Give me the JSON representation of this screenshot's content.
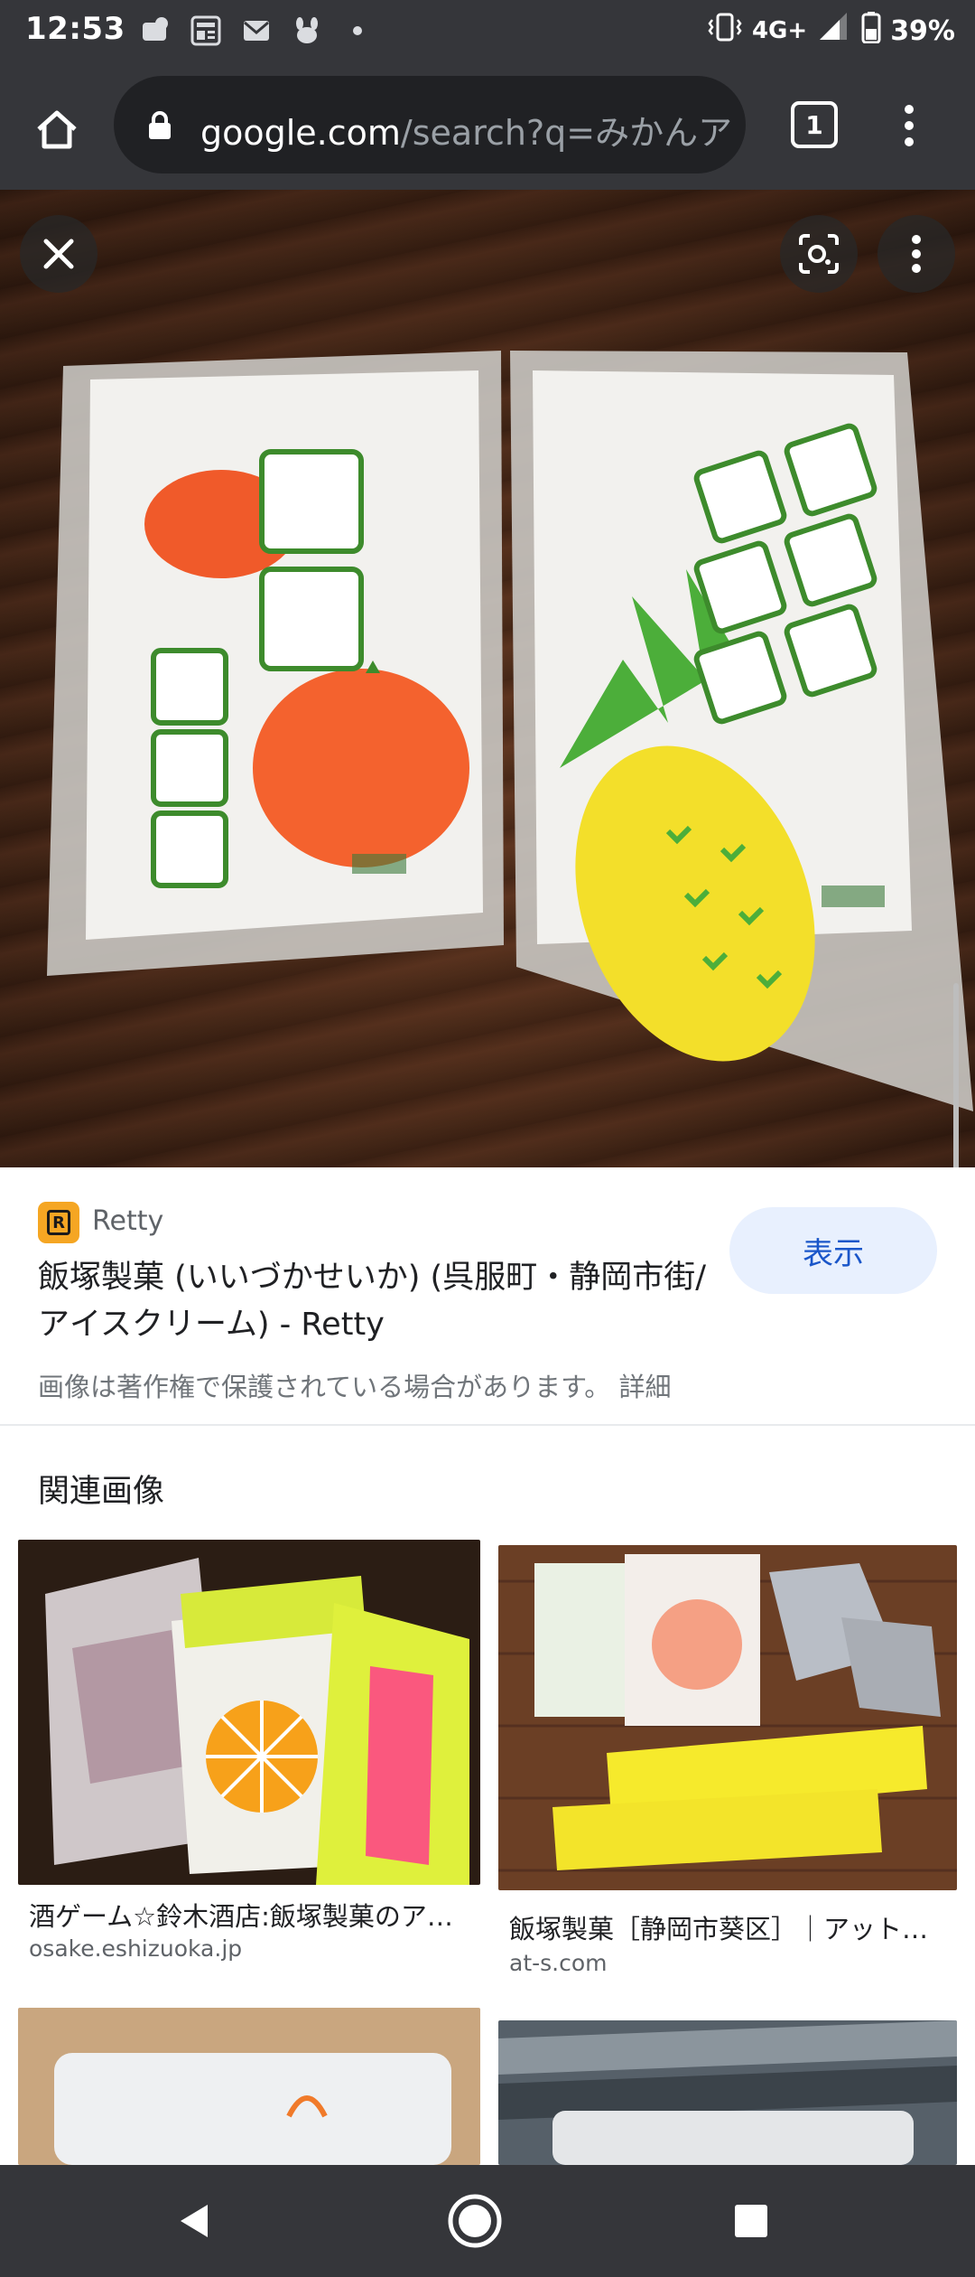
{
  "status_bar": {
    "time": "12:53",
    "network": "4G+",
    "battery": "39%",
    "icons_left": [
      "app-icon",
      "news-icon",
      "mail-icon",
      "pet-icon",
      "dot-icon"
    ],
    "icons_right": [
      "vibrate-icon",
      "signal-icon",
      "battery-icon"
    ]
  },
  "browser": {
    "url_host": "google.com",
    "url_path": "/search?q=みかんア",
    "tab_count": "1"
  },
  "source": {
    "site": "Retty",
    "favicon_letter": "R",
    "title": "飯塚製菓 (いいづかせいか) (呉服町・静岡市街/アイスクリーム) - Retty",
    "visit_label": "表示",
    "copyright": "画像は著作権で保護されている場合があります。",
    "details": "詳細"
  },
  "related": {
    "heading": "関連画像",
    "items": [
      {
        "caption": "酒ゲーム☆鈴木酒店:飯塚製菓のア…",
        "domain": "osake.eshizuoka.jp"
      },
      {
        "caption": "飯塚製菓［静岡市葵区］｜アット…",
        "domain": "at-s.com"
      }
    ]
  },
  "colors": {
    "chrome_bg": "#35363a",
    "omnibox_bg": "#202124",
    "visit_button_bg": "#e8f0fe",
    "visit_button_text": "#1a56c9",
    "favicon": "#f5a623"
  }
}
